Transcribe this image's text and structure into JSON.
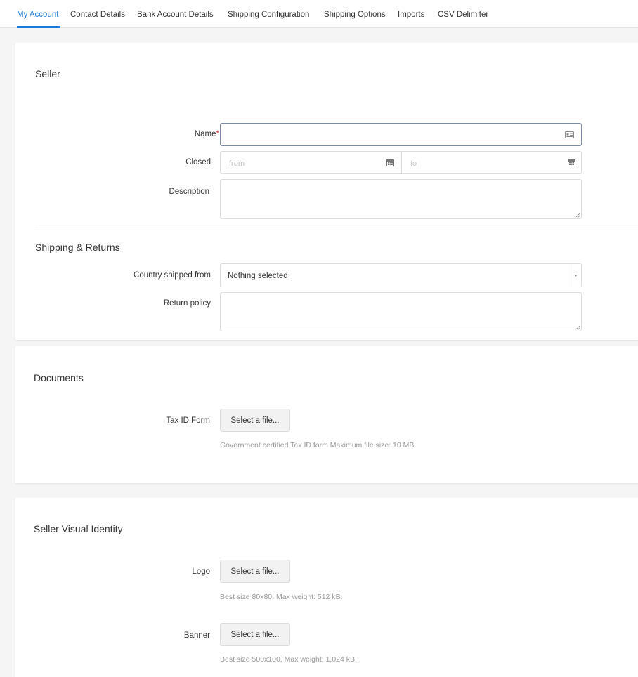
{
  "tabs": [
    {
      "label": "My Account",
      "active": true
    },
    {
      "label": "Contact Details"
    },
    {
      "label": "Bank Account Details"
    },
    {
      "label": "Shipping Configuration"
    },
    {
      "label": "Shipping Options"
    },
    {
      "label": "Imports"
    },
    {
      "label": "CSV Delimiter"
    }
  ],
  "seller": {
    "title": "Seller",
    "name_label": "Name",
    "required_mark": "*",
    "closed_label": "Closed",
    "closed_from_placeholder": "from",
    "closed_to_placeholder": "to",
    "description_label": "Description"
  },
  "shipping": {
    "title": "Shipping & Returns",
    "country_label": "Country shipped from",
    "country_value": "Nothing selected",
    "return_label": "Return policy"
  },
  "documents": {
    "title": "Documents",
    "tax_label": "Tax ID Form",
    "tax_button": "Select a file...",
    "tax_help": "Government certified Tax ID form Maximum file size: 10 MB"
  },
  "visual": {
    "title": "Seller Visual Identity",
    "logo_label": "Logo",
    "logo_button": "Select a file...",
    "logo_help": "Best size 80x80, Max weight: 512 kB.",
    "banner_label": "Banner",
    "banner_button": "Select a file...",
    "banner_help": "Best size 500x100, Max weight: 1,024 kB."
  },
  "colors": {
    "accent": "#1f7bd6",
    "required": "#e0373c"
  },
  "icons": [
    "id-card-icon",
    "calendar-icon",
    "caret-down-icon",
    "resize-handle-icon"
  ]
}
